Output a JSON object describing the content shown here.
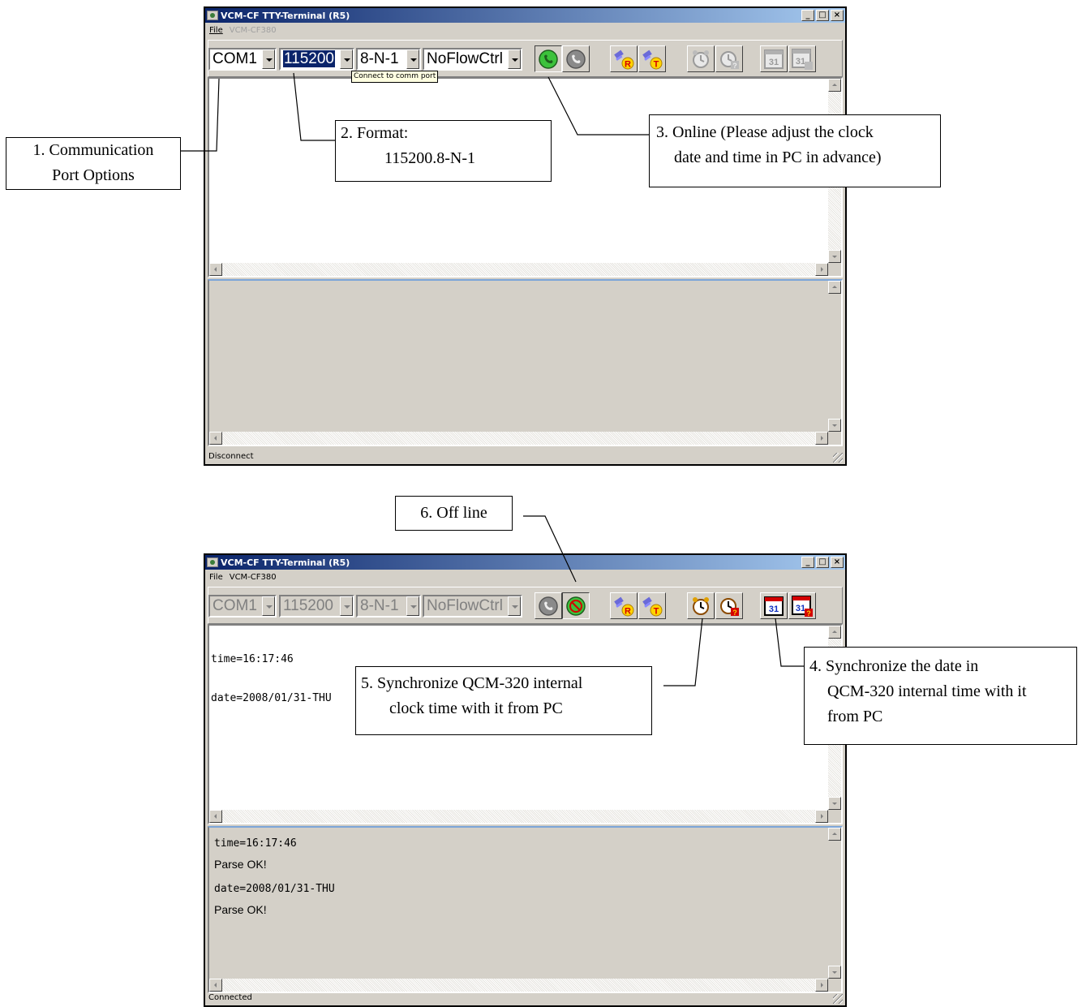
{
  "window1": {
    "title": "VCM-CF TTY-Terminal (R5)",
    "menu": [
      "File",
      "VCM-CF380"
    ],
    "combos": {
      "port": "COM1",
      "baud": "115200",
      "format": "8-N-1",
      "flow": "NoFlowCtrl"
    },
    "tooltip": "Connect to comm port",
    "status": "Disconnect"
  },
  "window2": {
    "title": "VCM-CF TTY-Terminal (R5)",
    "menu": [
      "File",
      "VCM-CF380"
    ],
    "combos": {
      "port": "COM1",
      "baud": "115200",
      "format": "8-N-1",
      "flow": "NoFlowCtrl"
    },
    "terminal_lines": [
      "time=16:17:46",
      "date=2008/01/31-THU"
    ],
    "log": {
      "l1": "time=16:17:46",
      "l2": "Parse OK!",
      "l3": "date=2008/01/31-THU",
      "l4": "Parse OK!"
    },
    "status": "Connected"
  },
  "callouts": {
    "c1_l1": "1. Communication",
    "c1_l2": "Port Options",
    "c2_l1": "2. Format:",
    "c2_l2": "115200.8-N-1",
    "c3_l1": "3. Online (Please adjust the clock",
    "c3_l2": "date and time in PC in advance)",
    "c4_l1": "4. Synchronize the date in",
    "c4_l2": "QCM-320 internal time with it",
    "c4_l3": "from PC",
    "c5_l1": "5. Synchronize QCM-320 internal",
    "c5_l2": "clock time with it from PC",
    "c6": "6. Off line"
  },
  "icons": {
    "connect": "connect-phone-icon",
    "disconnect": "disconnect-phone-icon",
    "receive": "receive-R-icon",
    "transmit": "transmit-T-icon",
    "clock_sync": "alarm-clock-icon",
    "clock_query": "alarm-clock-query-icon",
    "date_sync": "calendar-31-icon",
    "date_query": "calendar-31-query-icon"
  }
}
